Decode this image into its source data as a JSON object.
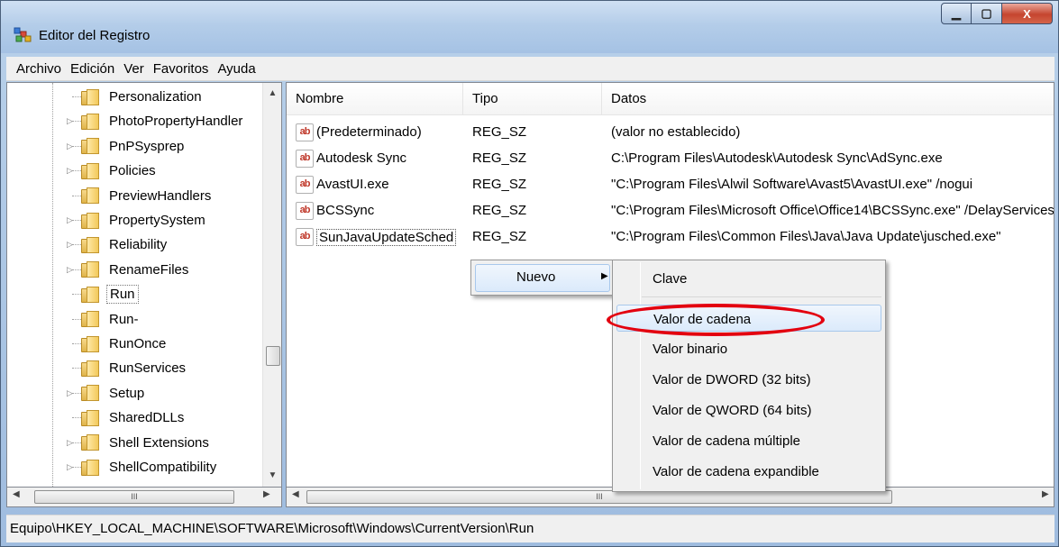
{
  "window": {
    "title": "Editor del Registro",
    "close_label": "X"
  },
  "menu": [
    "Archivo",
    "Edición",
    "Ver",
    "Favoritos",
    "Ayuda"
  ],
  "tree": {
    "items": [
      {
        "label": "Personalization",
        "expandable": false
      },
      {
        "label": "PhotoPropertyHandler",
        "expandable": true
      },
      {
        "label": "PnPSysprep",
        "expandable": true
      },
      {
        "label": "Policies",
        "expandable": true
      },
      {
        "label": "PreviewHandlers",
        "expandable": false
      },
      {
        "label": "PropertySystem",
        "expandable": true
      },
      {
        "label": "Reliability",
        "expandable": true
      },
      {
        "label": "RenameFiles",
        "expandable": true
      },
      {
        "label": "Run",
        "expandable": false,
        "selected": true
      },
      {
        "label": "Run-",
        "expandable": false
      },
      {
        "label": "RunOnce",
        "expandable": false
      },
      {
        "label": "RunServices",
        "expandable": false
      },
      {
        "label": "Setup",
        "expandable": true
      },
      {
        "label": "SharedDLLs",
        "expandable": false
      },
      {
        "label": "Shell Extensions",
        "expandable": true
      },
      {
        "label": "ShellCompatibility",
        "expandable": true
      }
    ]
  },
  "list": {
    "columns": [
      "Nombre",
      "Tipo",
      "Datos"
    ],
    "rows": [
      {
        "name": "(Predeterminado)",
        "type": "REG_SZ",
        "data": "(valor no establecido)"
      },
      {
        "name": "Autodesk Sync",
        "type": "REG_SZ",
        "data": "C:\\Program Files\\Autodesk\\Autodesk Sync\\AdSync.exe"
      },
      {
        "name": "AvastUI.exe",
        "type": "REG_SZ",
        "data": "\"C:\\Program Files\\Alwil Software\\Avast5\\AvastUI.exe\" /nogui"
      },
      {
        "name": "BCSSync",
        "type": "REG_SZ",
        "data": "\"C:\\Program Files\\Microsoft Office\\Office14\\BCSSync.exe\" /DelayServices"
      },
      {
        "name": "SunJavaUpdateSched",
        "type": "REG_SZ",
        "data": "\"C:\\Program Files\\Common Files\\Java\\Java Update\\jusched.exe\""
      }
    ],
    "value_icon_text": "ab"
  },
  "context_menu": {
    "label": "Nuevo",
    "submenu": [
      "Clave",
      "Valor de cadena",
      "Valor binario",
      "Valor de DWORD (32 bits)",
      "Valor de QWORD (64 bits)",
      "Valor de cadena múltiple",
      "Valor de cadena expandible"
    ],
    "highlighted": "Valor de cadena"
  },
  "status": {
    "path": "Equipo\\HKEY_LOCAL_MACHINE\\SOFTWARE\\Microsoft\\Windows\\CurrentVersion\\Run"
  },
  "colors": {
    "annotation": "#e3000f",
    "highlight": "#dbeafb"
  }
}
